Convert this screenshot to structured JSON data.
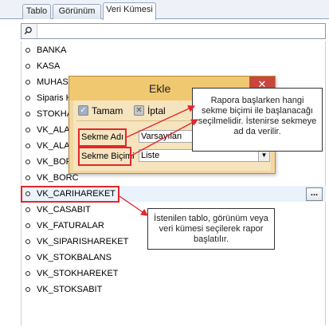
{
  "tabs": [
    {
      "label": "Tablo",
      "active": false
    },
    {
      "label": "Görünüm",
      "active": false
    },
    {
      "label": "Veri Kümesi",
      "active": true
    }
  ],
  "search": {
    "placeholder": "",
    "value": "",
    "icon": "search-icon"
  },
  "list": {
    "items": [
      "BANKA",
      "KASA",
      "MUHASE",
      "Siparis H",
      "STOKHA",
      "VK_ALAC",
      "VK_ALAC",
      "VK_BORC",
      "VK_BORC",
      "VK_CARIHAREKET",
      "VK_CASABIT",
      "VK_FATURALAR",
      "VK_SIPARISHAREKET",
      "VK_STOKBALANS",
      "VK_STOKHAREKET",
      "VK_STOKSABIT"
    ],
    "selected_index": 9,
    "row_button_label": "..."
  },
  "dialog": {
    "title": "Ekle",
    "close_label": "✕",
    "ok_label": "Tamam",
    "cancel_label": "İptal",
    "tab_name_label": "Sekme Adı",
    "tab_name_value": "Varsayılan",
    "tab_style_label": "Sekme Biçimi",
    "tab_style_value": "Liste",
    "combo_arrow": "▼"
  },
  "callouts": {
    "dialog_note": "Rapora başlarken hangi sekme biçimi ile başlanacağı seçilmelidir. İstenirse sekmeye ad da verilir.",
    "list_note": "İstenilen tablo, görünüm veya veri kümesi seçilerek rapor başlatılır."
  },
  "colors": {
    "highlight": "#e3262d",
    "dialog_title_bg": "#f0c870",
    "dialog_body_bg": "#f6e4be",
    "close_button": "#c9463d"
  }
}
